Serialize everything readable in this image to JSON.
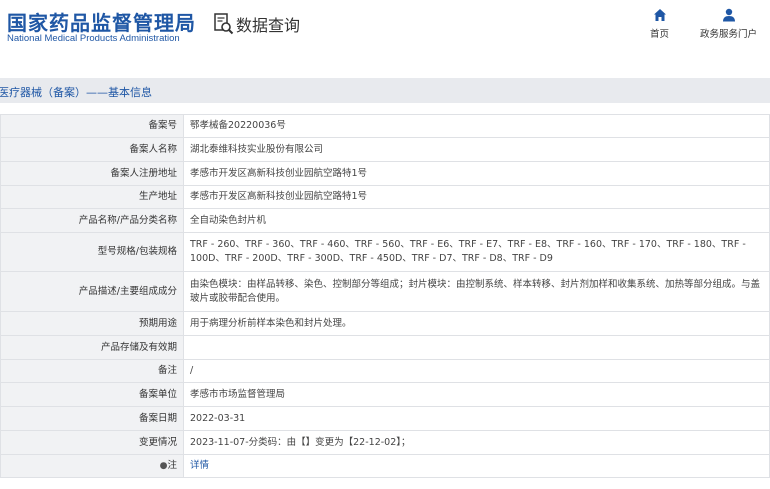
{
  "header": {
    "logo_cn": "国家药品监督管理局",
    "logo_en": "National Medical Products Administration",
    "search_label": "数据查询",
    "nav": {
      "home": "首页",
      "portal": "政务服务门户"
    }
  },
  "title_bar": {
    "text": "医疗器械（备案）——基本信息"
  },
  "rows": [
    {
      "label": "备案号",
      "value": "鄂孝械备20220036号"
    },
    {
      "label": "备案人名称",
      "value": "湖北泰维科技实业股份有限公司"
    },
    {
      "label": "备案人注册地址",
      "value": "孝感市开发区高新科技创业园航空路特1号"
    },
    {
      "label": "生产地址",
      "value": "孝感市开发区高新科技创业园航空路特1号"
    },
    {
      "label": "产品名称/产品分类名称",
      "value": "全自动染色封片机"
    },
    {
      "label": "型号规格/包装规格",
      "value": "TRF - 260、TRF - 360、TRF - 460、TRF - 560、TRF - E6、TRF - E7、TRF - E8、TRF - 160、TRF - 170、TRF - 180、TRF - 100D、TRF - 200D、TRF - 300D、TRF - 450D、TRF - D7、TRF - D8、TRF - D9"
    },
    {
      "label": "产品描述/主要组成成分",
      "value": "由染色模块：由样品转移、染色、控制部分等组成；封片模块：由控制系统、样本转移、封片剂加样和收集系统、加热等部分组成。与盖玻片或胶带配合使用。"
    },
    {
      "label": "预期用途",
      "value": "用于病理分析前样本染色和封片处理。"
    },
    {
      "label": "产品存储及有效期",
      "value": ""
    },
    {
      "label": "备注",
      "value": "/"
    },
    {
      "label": "备案单位",
      "value": "孝感市市场监督管理局"
    },
    {
      "label": "备案日期",
      "value": "2022-03-31"
    },
    {
      "label": "变更情况",
      "value": "2023-11-07-分类码：由【】变更为【22-12-02】；"
    },
    {
      "label": "注",
      "value": "详情"
    }
  ],
  "colors": {
    "brand_blue": "#1f57a5",
    "label_bg": "#f1f2f4",
    "title_bar_bg": "#e8eaee"
  },
  "icons": {
    "search": "search-document-icon",
    "home": "home-icon",
    "portal": "user-icon",
    "note": "pin-icon"
  }
}
